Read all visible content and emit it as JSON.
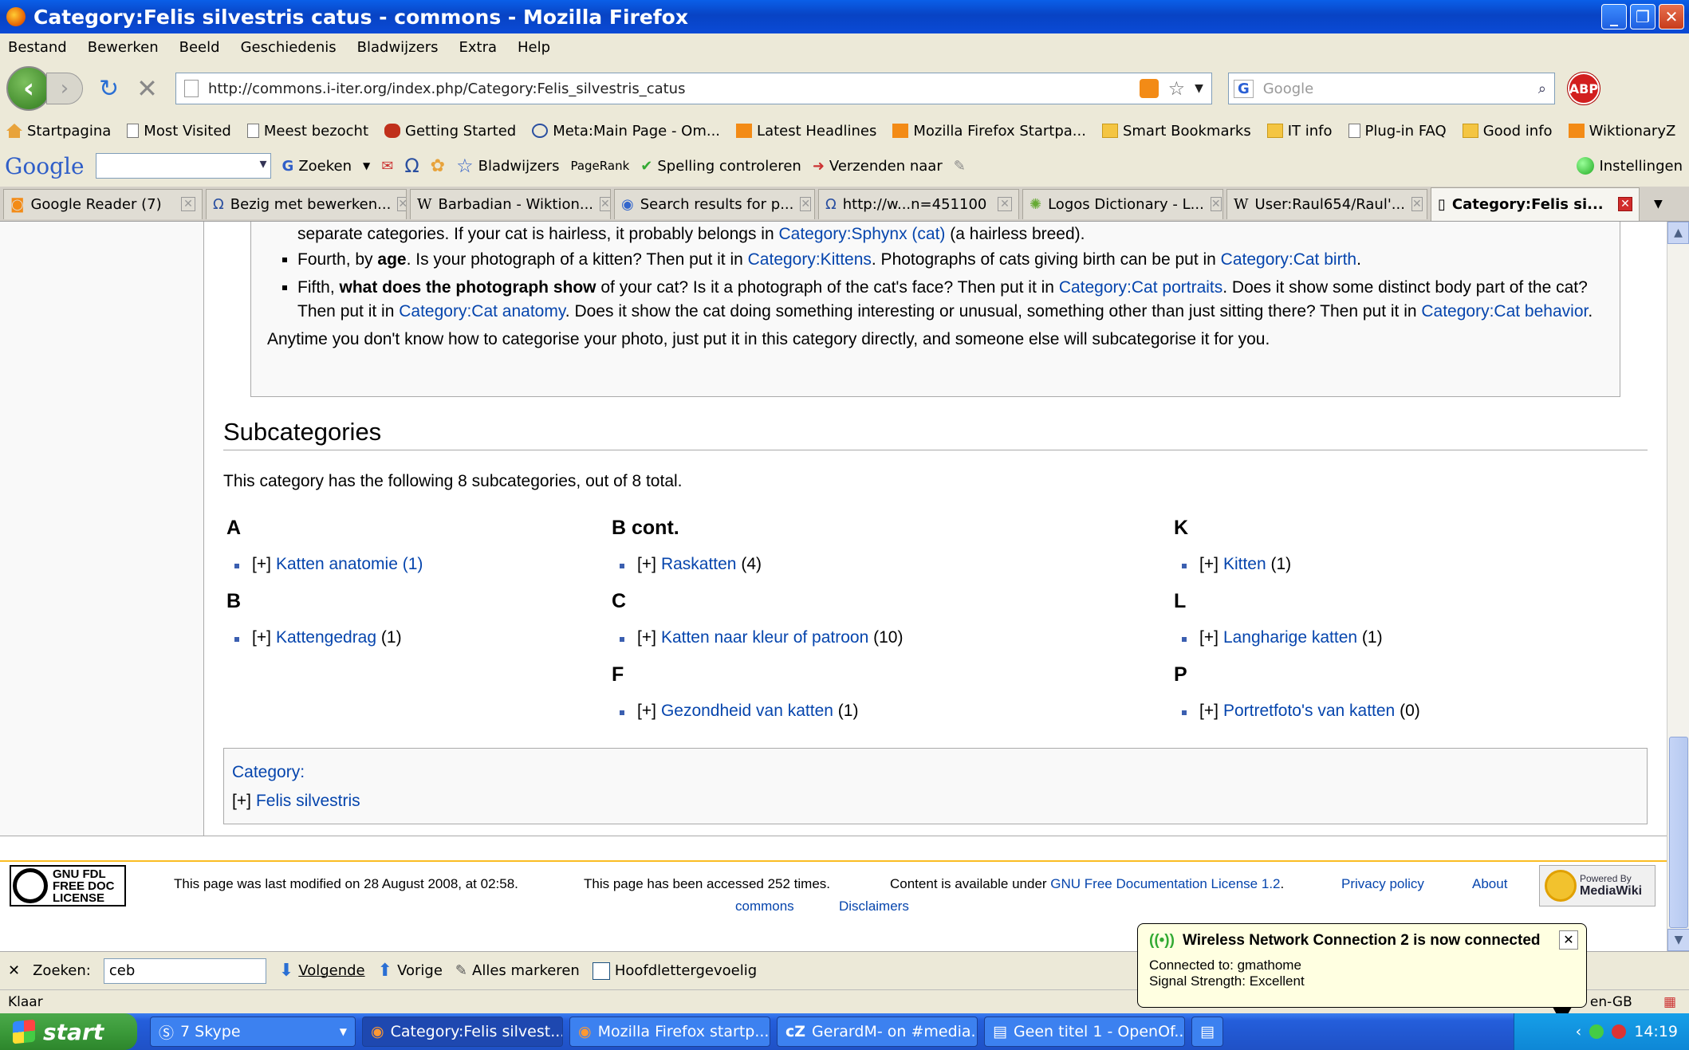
{
  "window": {
    "title": "Category:Felis silvestris catus - commons - Mozilla Firefox",
    "minimize": "_",
    "restore": "❐",
    "close": "✕"
  },
  "menu": [
    "Bestand",
    "Bewerken",
    "Beeld",
    "Geschiedenis",
    "Bladwijzers",
    "Extra",
    "Help"
  ],
  "nav": {
    "back": "‹",
    "forward": "›",
    "url": "http://commons.i-iter.org/index.php/Category:Felis_silvestris_catus",
    "search_placeholder": "Google",
    "search_engine": "G",
    "abp": "ABP"
  },
  "bookmarks": [
    {
      "label": "Startpagina",
      "icon": "home"
    },
    {
      "label": "Most Visited",
      "icon": "page"
    },
    {
      "label": "Meest bezocht",
      "icon": "page"
    },
    {
      "label": "Getting Started",
      "icon": "red"
    },
    {
      "label": "Meta:Main Page - Om...",
      "icon": "meta"
    },
    {
      "label": "Latest Headlines",
      "icon": "rss"
    },
    {
      "label": "Mozilla Firefox Startpa...",
      "icon": "rss"
    },
    {
      "label": "Smart Bookmarks",
      "icon": "folder"
    },
    {
      "label": "IT info",
      "icon": "folder"
    },
    {
      "label": "Plug-in FAQ",
      "icon": "page"
    },
    {
      "label": "Good info",
      "icon": "folder"
    },
    {
      "label": "WiktionaryZ",
      "icon": "rss"
    }
  ],
  "google_toolbar": {
    "logo": "Google",
    "search": "Zoeken",
    "bookmarks": "Bladwijzers",
    "pagerank": "PageRank",
    "spell": "Spelling controleren",
    "send": "Verzenden naar",
    "settings": "Instellingen"
  },
  "tabs": [
    {
      "label": "Google Reader (7)",
      "active": false
    },
    {
      "label": "Bezig met bewerken...",
      "active": false
    },
    {
      "label": "Barbadian - Wiktion...",
      "active": false
    },
    {
      "label": "Search results for p...",
      "active": false
    },
    {
      "label": "http://w...n=451100",
      "active": false
    },
    {
      "label": "Logos Dictionary - L...",
      "active": false
    },
    {
      "label": "User:Raul654/Raul'...",
      "active": false
    },
    {
      "label": "Category:Felis si...",
      "active": true
    }
  ],
  "infobox": {
    "line0_a": "separate categories. If your cat is hairless, it probably belongs in ",
    "line0_link": "Category:Sphynx (cat)",
    "line0_b": " (a hairless breed).",
    "item4_a": "Fourth, by ",
    "item4_bold": "age",
    "item4_b": ". Is your photograph of a kitten? Then put it in ",
    "item4_link1": "Category:Kittens",
    "item4_c": ". Photographs of cats giving birth can be put in ",
    "item4_link2": "Category:Cat birth",
    "item4_d": ".",
    "item5_a": "Fifth, ",
    "item5_bold": "what does the photograph show",
    "item5_b": " of your cat? Is it a photograph of the cat's face? Then put it in ",
    "item5_link1": "Category:Cat portraits",
    "item5_c": ". Does it show some distinct body part of the cat? Then put it in ",
    "item5_link2": "Category:Cat anatomy",
    "item5_d": ". Does it show the cat doing something interesting or unusual, something other than just sitting there? Then put it in ",
    "item5_link3": "Category:Cat behavior",
    "item5_e": ".",
    "closing": "Anytime you don't know how to categorise your photo, just put it in this category directly, and someone else will subcategorise it for you."
  },
  "subcategories": {
    "heading": "Subcategories",
    "intro": "This category has the following 8 subcategories, out of 8 total.",
    "expander": "[+]",
    "columns": [
      [
        {
          "letter": "A",
          "items": [
            {
              "name": "Katten anatomie",
              "count": "(1)"
            }
          ]
        },
        {
          "letter": "B",
          "items": [
            {
              "name": "Kattengedrag",
              "count": "(1)"
            }
          ]
        }
      ],
      [
        {
          "letter": "B cont.",
          "items": [
            {
              "name": "Raskatten",
              "count": "(4)"
            }
          ]
        },
        {
          "letter": "C",
          "items": [
            {
              "name": "Katten naar kleur of patroon",
              "count": "(10)"
            }
          ]
        },
        {
          "letter": "F",
          "items": [
            {
              "name": "Gezondheid van katten",
              "count": "(1)"
            }
          ]
        }
      ],
      [
        {
          "letter": "K",
          "items": [
            {
              "name": "Kitten",
              "count": "(1)"
            }
          ]
        },
        {
          "letter": "L",
          "items": [
            {
              "name": "Langharige katten",
              "count": "(1)"
            }
          ]
        },
        {
          "letter": "P",
          "items": [
            {
              "name": "Portretfoto's van katten",
              "count": "(0)"
            }
          ]
        }
      ]
    ]
  },
  "catbox": {
    "label": "Category:",
    "expander": "[+]",
    "link": "Felis silvestris"
  },
  "footer": {
    "gnu_line1": "GNU FDL",
    "gnu_line2": "FREE DOC",
    "gnu_line3": "LICENSE",
    "modified": "This page was last modified on 28 August 2008, at 02:58.",
    "accessed": "This page has been accessed 252 times.",
    "content_a": "Content is available under ",
    "license_link": "GNU Free Documentation License 1.2",
    "content_b": ".",
    "privacy": "Privacy policy",
    "about": "About",
    "commons": "commons",
    "disclaimers": "Disclaimers",
    "mw_line1": "Powered By",
    "mw_line2": "MediaWiki"
  },
  "findbar": {
    "close": "✕",
    "label": "Zoeken:",
    "value": "ceb",
    "next": "Volgende",
    "prev": "Vorige",
    "highlight": "Alles markeren",
    "matchcase": "Hoofdlettergevoelig"
  },
  "status": {
    "text": "Klaar",
    "locale": "h: en-GB"
  },
  "balloon": {
    "title": "Wireless Network Connection 2 is now connected",
    "line1": "Connected to: gmathome",
    "line2": "Signal Strength: Excellent",
    "close": "✕"
  },
  "taskbar": {
    "start": "start",
    "tasks": [
      {
        "label": "7 Skype",
        "active": false
      },
      {
        "label": "Category:Felis silvest...",
        "active": true
      },
      {
        "label": "Mozilla Firefox startp...",
        "active": false
      },
      {
        "label": "GerardM- on #media...",
        "active": false
      },
      {
        "label": "Geen titel 1 - OpenOf...",
        "active": false
      },
      {
        "label": "",
        "active": false
      }
    ],
    "clock": "14:19"
  }
}
